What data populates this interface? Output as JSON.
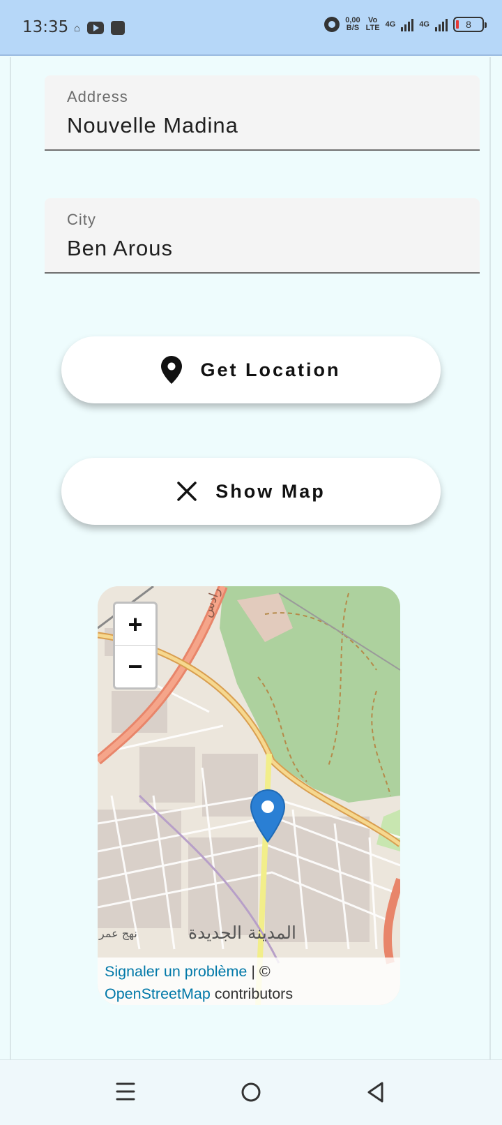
{
  "status_bar": {
    "time": "13:35",
    "net_speed_value": "0,00",
    "net_speed_unit": "B/S",
    "volte_top": "Vo",
    "volte_bottom": "LTE",
    "net1": "4G",
    "net2": "4G",
    "battery": "8"
  },
  "form": {
    "address": {
      "label": "Address",
      "value": "Nouvelle Madina"
    },
    "city": {
      "label": "City",
      "value": "Ben Arous"
    }
  },
  "buttons": {
    "get_location": "Get Location",
    "show_map": "Show Map"
  },
  "map": {
    "place_label": "المدينة الجديدة",
    "place_label_small": "نهج عمر",
    "road_label": "معتمدية رادس",
    "zoom_in": "+",
    "zoom_out": "−",
    "attribution": {
      "report_link": "Signaler un problème",
      "separator": " | ©",
      "osm_link": "OpenStreetMap",
      "contributors": " contributors"
    }
  },
  "colors": {
    "status_bar": "#b6d7f8",
    "background": "#eefcfd",
    "marker": "#2a7fd4",
    "link": "#0078a8"
  },
  "icons": {
    "get_location": "location-pin-icon",
    "show_map": "close-icon",
    "nav_menu": "menu-icon",
    "nav_home": "home-circle-icon",
    "nav_back": "back-triangle-icon"
  }
}
